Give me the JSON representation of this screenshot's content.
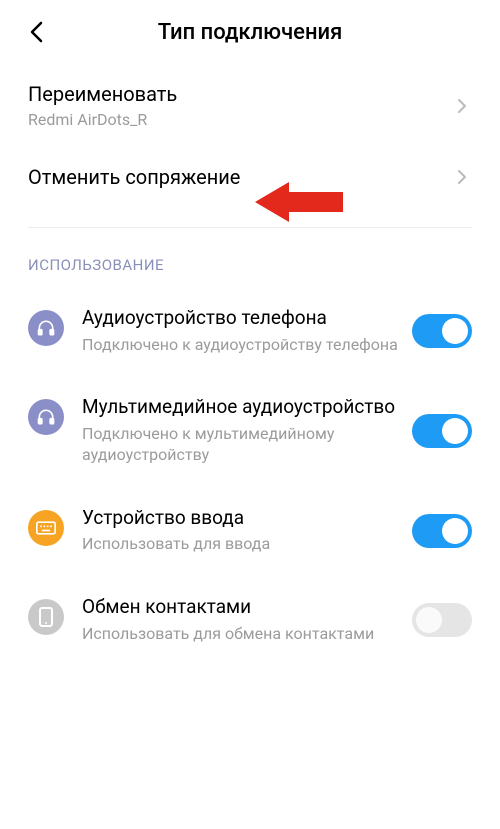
{
  "header": {
    "title": "Тип подключения"
  },
  "rows": {
    "rename": {
      "title": "Переименовать",
      "sub": "Redmi AirDots_R"
    },
    "unpair": {
      "title": "Отменить сопряжение"
    }
  },
  "section": {
    "usage_header": "ИСПОЛЬЗОВАНИЕ"
  },
  "usage": [
    {
      "title": "Аудиоустройство телефона",
      "sub": "Подключено к аудиоустройству телефона",
      "icon_bg": "#8a8fc7",
      "toggle": true
    },
    {
      "title": "Мультимедийное аудиоустройство",
      "sub": "Подключено к мультимедийному аудиоустройству",
      "icon_bg": "#8a8fc7",
      "toggle": true
    },
    {
      "title": "Устройство ввода",
      "sub": "Использовать для ввода",
      "icon_bg": "#f7a425",
      "toggle": true
    },
    {
      "title": "Обмен контактами",
      "sub": "Использовать для обмена контактами",
      "icon_bg": "#c9c9c9",
      "toggle": false
    }
  ],
  "colors": {
    "accent": "#1e9bf5",
    "arrow": "#e3281c"
  }
}
